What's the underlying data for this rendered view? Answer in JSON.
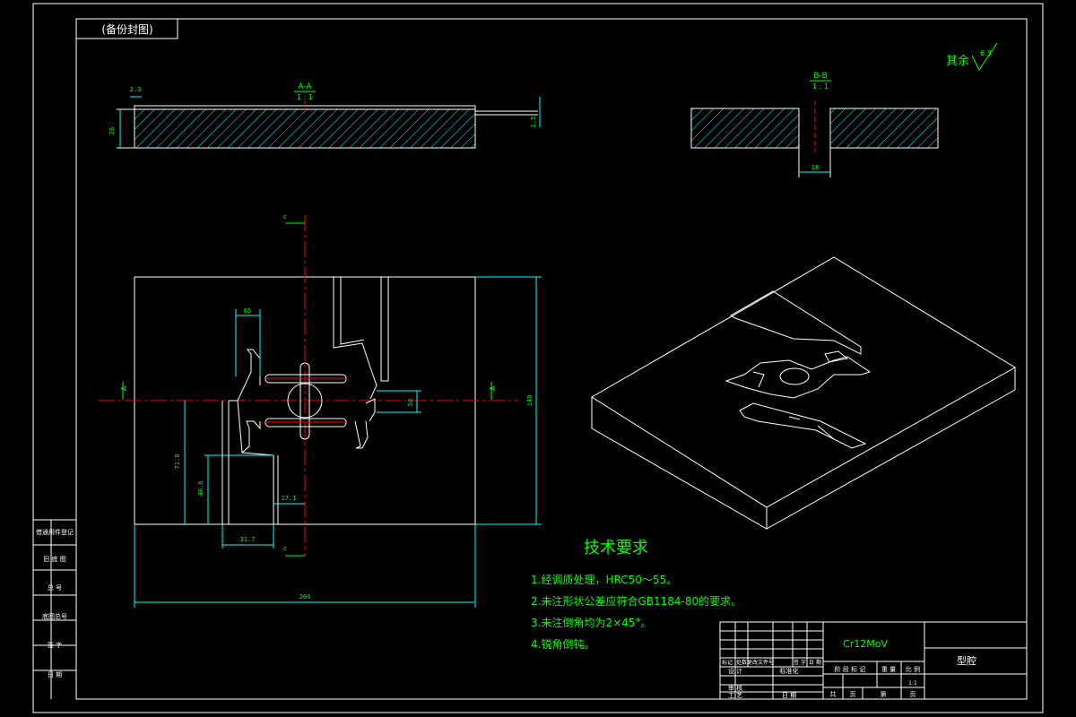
{
  "frame": {
    "corner_tag": "(备份封图)"
  },
  "views": {
    "section_aa": {
      "label": "A-A",
      "scale": "1 : 1",
      "dim_top": "2.3",
      "dim_height": "26",
      "dim_right": "1.5"
    },
    "section_bb": {
      "label": "B-B",
      "scale": "1 : 1",
      "dim_gap": "18"
    },
    "plan": {
      "marker_c": "c",
      "marker_a": "A",
      "dims": {
        "w65": "65",
        "h58": "58",
        "h71": "71.8",
        "h40": "40.6",
        "w17": "17.1",
        "w31": "31.7",
        "total_w": "200",
        "total_h": "140"
      }
    }
  },
  "surface_finish": {
    "label": "其余",
    "value": "6.3"
  },
  "tech_requirements": {
    "title": "技术要求",
    "items": [
      "1.经调质处理，HRC50～55。",
      "2.未注形状公差应符合GB1184-80的要求。",
      "3.未注倒角均为2×45°。",
      "4.锐角倒钝。"
    ]
  },
  "left_stamps": {
    "items": [
      "借通用件登记",
      "旧 底 图",
      "总 号",
      "底图总号",
      "签 字",
      "日 期"
    ]
  },
  "title_block": {
    "material": "Cr12MoV",
    "part_name": "型腔",
    "row_labels": [
      "标记",
      "处数",
      "更改文件号",
      "签 字",
      "日 期"
    ],
    "design": "设 计",
    "standardize": "标准化",
    "check": "审 核",
    "process": "工 艺",
    "date": "日 期",
    "stage_mark": "阶 段 标 记",
    "weight": "重 量",
    "ratio": "比 例",
    "scale_value": "1:1",
    "sheets": "共",
    "sheet_unit": "页",
    "sheet_no": "第",
    "sheet_no_unit": "页"
  }
}
